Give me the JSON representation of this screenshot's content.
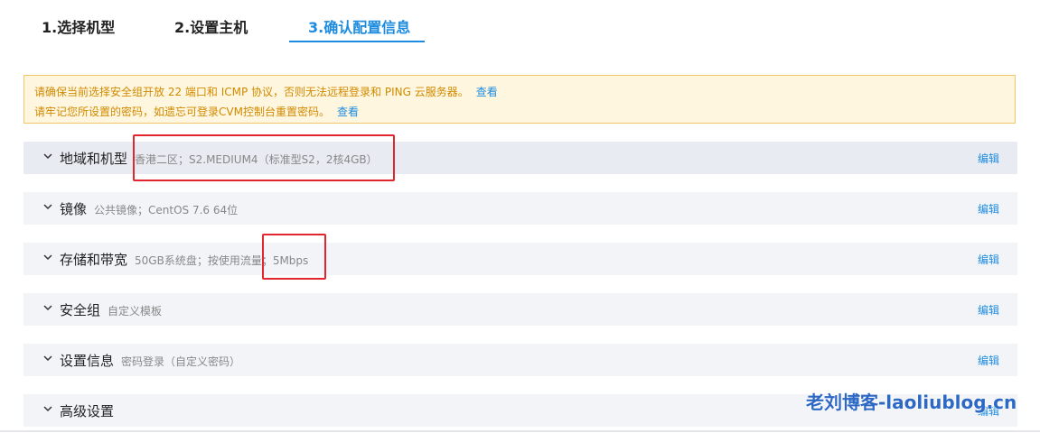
{
  "steps": [
    {
      "label": "1.选择机型",
      "active": false
    },
    {
      "label": "2.设置主机",
      "active": false
    },
    {
      "label": "3.确认配置信息",
      "active": true
    }
  ],
  "notice": {
    "line1": "请确保当前选择安全组开放 22 端口和 ICMP 协议，否则无法远程登录和 PING 云服务器。",
    "line1_link": "查看",
    "line2": "请牢记您所设置的密码，如遗忘可登录CVM控制台重置密码。",
    "line2_link": "查看"
  },
  "sections": [
    {
      "title": "地域和机型",
      "summary": "香港二区；S2.MEDIUM4（标准型S2，2核4GB）",
      "edit": "编辑"
    },
    {
      "title": "镜像",
      "summary": "公共镜像；CentOS 7.6 64位",
      "edit": "编辑"
    },
    {
      "title": "存储和带宽",
      "summary": "50GB系统盘；按使用流量；5Mbps",
      "edit": "编辑"
    },
    {
      "title": "安全组",
      "summary": "自定义模板",
      "edit": "编辑"
    },
    {
      "title": "设置信息",
      "summary": "密码登录（自定义密码）",
      "edit": "编辑"
    },
    {
      "title": "高级设置",
      "summary": "",
      "edit": "编辑"
    }
  ],
  "watermark": "老刘博客-laoliublog.cn",
  "colors": {
    "accent": "#1d8ce0",
    "notice_bg": "#fff6df",
    "notice_text": "#d08a00",
    "annotation": "#e3262e"
  }
}
